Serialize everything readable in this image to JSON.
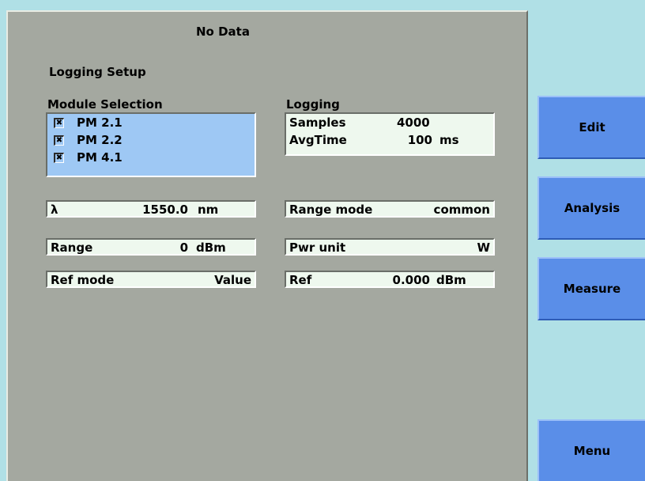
{
  "status_title": "No Data",
  "page_title": "Logging Setup",
  "module_selection": {
    "heading": "Module Selection",
    "items": [
      {
        "label": "PM 2.1",
        "check": "✖"
      },
      {
        "label": "PM 2.2",
        "check": "✖"
      },
      {
        "label": "PM 4.1",
        "check": "✖"
      }
    ]
  },
  "logging": {
    "heading": "Logging",
    "samples_label": "Samples",
    "samples_value": "4000",
    "avgtime_label": "AvgTime",
    "avgtime_value": "100",
    "avgtime_unit": "ms"
  },
  "wavelength": {
    "symbol": "λ",
    "value": "1550.0",
    "unit": "nm"
  },
  "range": {
    "label": "Range",
    "value": "0",
    "unit": "dBm"
  },
  "ref_mode": {
    "label": "Ref mode",
    "value": "Value"
  },
  "range_mode": {
    "label": "Range mode",
    "value": "common"
  },
  "pwr_unit": {
    "label": "Pwr unit",
    "value": "W"
  },
  "ref": {
    "label": "Ref",
    "value": "0.000",
    "unit": "dBm"
  },
  "softkeys": {
    "edit": "Edit",
    "analysis": "Analysis",
    "measure": "Measure",
    "menu": "Menu"
  },
  "colors": {
    "background": "#b0e0e6",
    "panel": "#a4a8a0",
    "button": "#5a8ee8",
    "selection": "#9ec8f4",
    "field": "#eef8ee"
  }
}
